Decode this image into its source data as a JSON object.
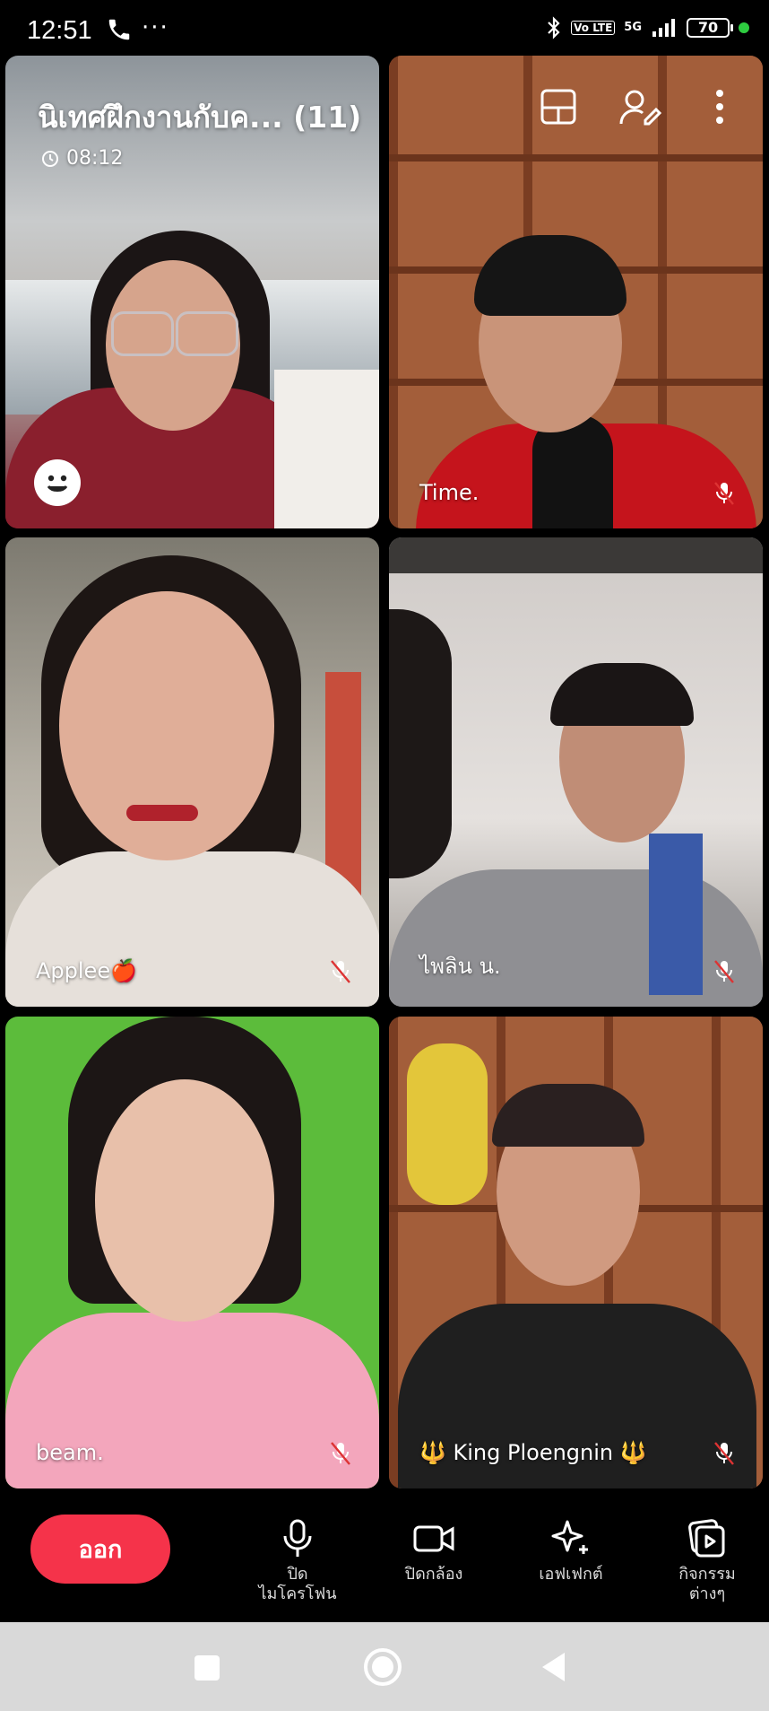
{
  "status_bar": {
    "time": "12:51",
    "dots": "···",
    "volte": "Vo LTE",
    "network": "5G",
    "battery": "70"
  },
  "call": {
    "title": "นิเทศฝึกงานกับค... (11)",
    "timer": "08:12"
  },
  "participants": [
    {
      "name": "",
      "muted": false
    },
    {
      "name": "Time.",
      "muted": true
    },
    {
      "name": "Applee🍎",
      "muted": true
    },
    {
      "name": "ไพลิน น.",
      "muted": true
    },
    {
      "name": "beam.",
      "muted": true
    },
    {
      "name": "🔱 King Ploengnin 🔱",
      "muted": true
    }
  ],
  "controls": {
    "leave": "ออก",
    "mic_line1": "ปิด",
    "mic_line2": "ไมโครโฟน",
    "camera": "ปิดกล้อง",
    "effects": "เอฟเฟกต์",
    "activities_line1": "กิจกรรม",
    "activities_line2": "ต่างๆ"
  },
  "colors": {
    "leave_button": "#f5334a",
    "background": "#000000"
  }
}
